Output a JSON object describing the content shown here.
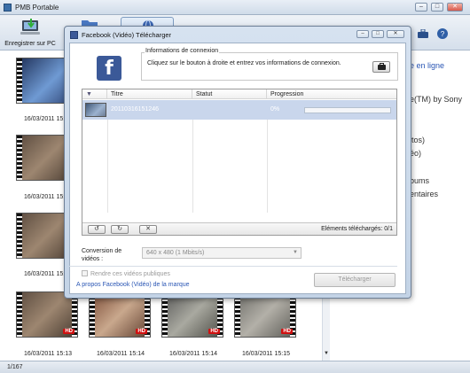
{
  "app": {
    "title": "PMB Portable",
    "toolbar": {
      "save_pc_label": "Enregistrer sur PC"
    },
    "status": {
      "count": "1/167"
    },
    "right_panel": {
      "lines": [
        "e en ligne",
        "e(TM) by Sony",
        "itos)",
        "éo)",
        "bums",
        "entaires"
      ]
    },
    "thumbnails": {
      "dates": [
        "16/03/2011 15:",
        "16/03/2011 15:",
        "16/03/2011 15:",
        "16/03/2011 15:13",
        "16/03/2011 15:14",
        "16/03/2011 15:14",
        "16/03/2011 15:15"
      ],
      "hd_badge": "HD"
    }
  },
  "dialog": {
    "title": "Facebook (Vidéo) Télécharger",
    "logo_letter": "f",
    "connection": {
      "legend": "Informations de connexion",
      "text": "Cliquez sur le bouton à droite et entrez vos informations de connexion."
    },
    "table": {
      "columns": [
        "",
        "Titre",
        "Statut",
        "Progression"
      ],
      "rows": [
        {
          "title": "20110316151246",
          "status": "",
          "progress_text": "0%",
          "progress": 0
        }
      ],
      "footer_status": "Eléments téléchargés: 0/1"
    },
    "conversion": {
      "label": "Conversion de vidéos :",
      "value": "640 x 480 (1 Mbits/s)"
    },
    "public_checkbox": "Rendre ces vidéos publiques",
    "about_link": "A propos Facebook (Vidéo) de la marque",
    "download_button": "Télécharger"
  }
}
